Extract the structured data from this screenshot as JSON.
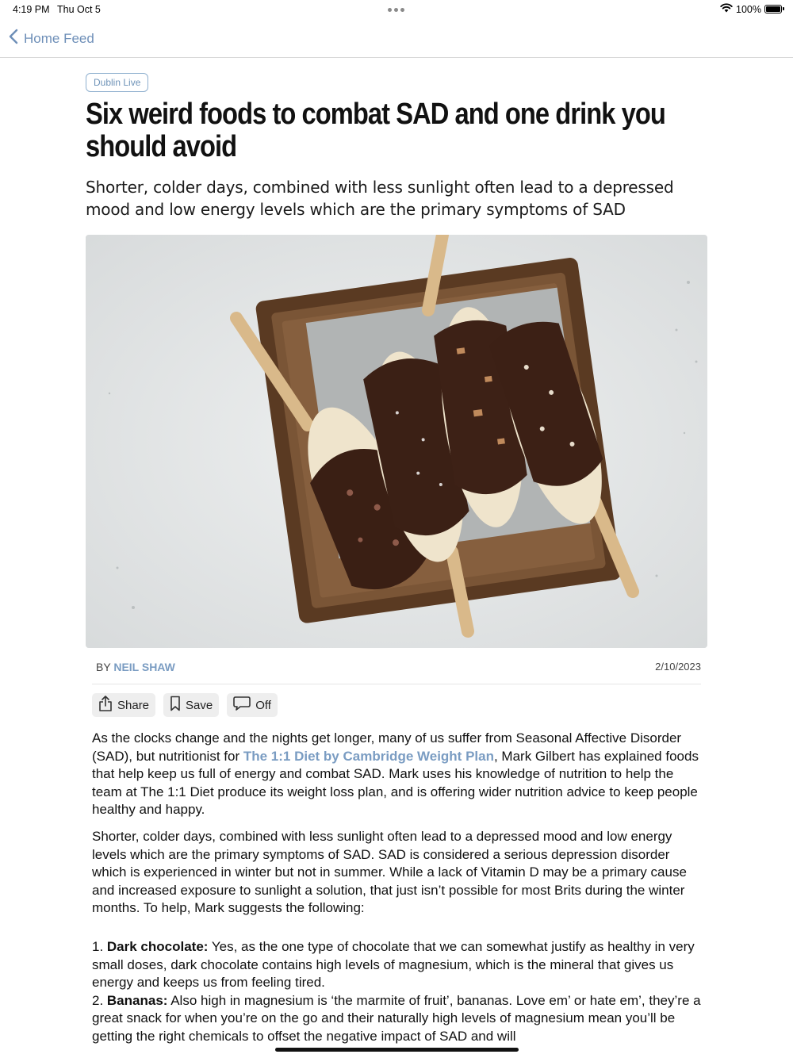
{
  "status_bar": {
    "time": "4:19 PM",
    "date": "Thu Oct 5",
    "battery": "100%"
  },
  "nav": {
    "back_label": "Home Feed"
  },
  "article": {
    "source": "Dublin Live",
    "headline": "Six weird foods to combat SAD and one drink you should avoid",
    "dek": "Shorter, colder days, combined with less sunlight often lead to a depressed mood and low energy levels which are the primary symptoms of SAD",
    "byline_prefix": "BY",
    "author": "NEIL SHAW",
    "date": "2/10/2023",
    "actions": {
      "share": "Share",
      "save": "Save",
      "comments": "Off"
    },
    "p1_a": "As the clocks change and the nights get longer, many of us suffer from Seasonal Affective Disorder (SAD), but nutritionist for ",
    "p1_link": "The 1:1 Diet by Cambridge Weight Plan",
    "p1_b": ", Mark Gilbert has explained foods that help keep us full of energy and combat SAD. Mark uses his knowledge of nutrition to help the team at The 1:1 Diet produce its weight loss plan, and is offering wider nutrition advice to keep people healthy and happy.",
    "p2": "Shorter, colder days, combined with less sunlight often lead to a depressed mood and low energy levels which are the primary symptoms of SAD. SAD is considered a serious depression disorder which is experienced in winter but not in summer. While a lack of Vitamin D may be a primary cause and increased exposure to sunlight a solution, that just isn’t possible for most Brits during the winter months. To help, Mark suggests the following:",
    "item1_num": "1. ",
    "item1_title": "Dark chocolate:",
    "item1_text": " Yes, as the one type of chocolate that we can somewhat justify as healthy in very small doses, dark chocolate contains high levels of magnesium, which is the mineral that gives us energy and keeps us from feeling tired.",
    "item2_num": "2. ",
    "item2_title": "Bananas:",
    "item2_text": " Also high in magnesium is ‘the marmite of fruit’, bananas. Love em’ or hate em’, they’re a great snack for when you’re on the go and their naturally high levels of magnesium mean you’ll be getting the right chemicals to offset the negative impact of SAD and will"
  },
  "icons": {
    "back": "chevron-left-icon",
    "share": "share-icon",
    "save": "bookmark-icon",
    "comments": "comment-icon",
    "wifi": "wifi-icon",
    "battery": "battery-icon"
  },
  "colors": {
    "accent": "#7a9cc2",
    "tag_border": "#8fb0cf"
  }
}
